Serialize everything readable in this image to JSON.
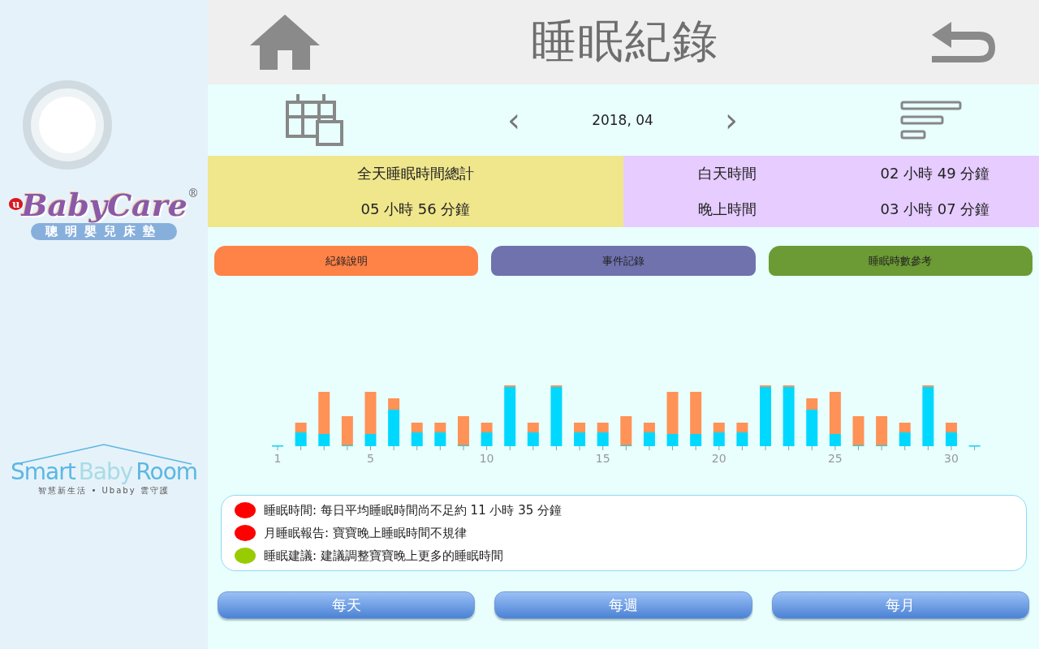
{
  "sidebar": {
    "brand_logo": {
      "mark": "u",
      "name": "BabyCare",
      "registered": "®",
      "tagline": "聰明嬰兒床墊"
    },
    "room_logo": {
      "words": [
        "Smart",
        "Baby",
        "Room"
      ],
      "tagline": "智慧新生活 • Ubaby 雲守護"
    }
  },
  "header": {
    "title": "睡眠紀錄"
  },
  "date_nav": {
    "prev": "‹",
    "date": "2018, 04",
    "next": "›"
  },
  "summary": {
    "total_label": "全天睡眠時間總計",
    "total_value": "05 小時 56 分鐘",
    "rows": [
      {
        "label": "白天時間",
        "value": "02 小時 49 分鐘"
      },
      {
        "label": "晚上時間",
        "value": "03 小時 07 分鐘"
      }
    ]
  },
  "tabs": [
    {
      "label": "紀錄說明",
      "color": "#ff8247"
    },
    {
      "label": "事件記錄",
      "color": "#7072ae"
    },
    {
      "label": "睡眠時數參考",
      "color": "#6c9a34"
    }
  ],
  "chart": {
    "x_labels": [
      "1",
      "5",
      "10",
      "15",
      "20",
      "25",
      "30"
    ]
  },
  "notes": [
    {
      "text": "睡眠時間: 每日平均睡眠時間尚不足約 11 小時 35 分鐘",
      "color": "#ff0000"
    },
    {
      "text": "月睡眠報告: 寶寶晚上睡眠時間不規律",
      "color": "#ff0000"
    },
    {
      "text": "睡眠建議: 建議調整寶寶晚上更多的睡眠時間",
      "color": "#99cc00"
    }
  ],
  "periods": [
    {
      "label": "每天"
    },
    {
      "label": "每週"
    },
    {
      "label": "每月"
    }
  ]
}
